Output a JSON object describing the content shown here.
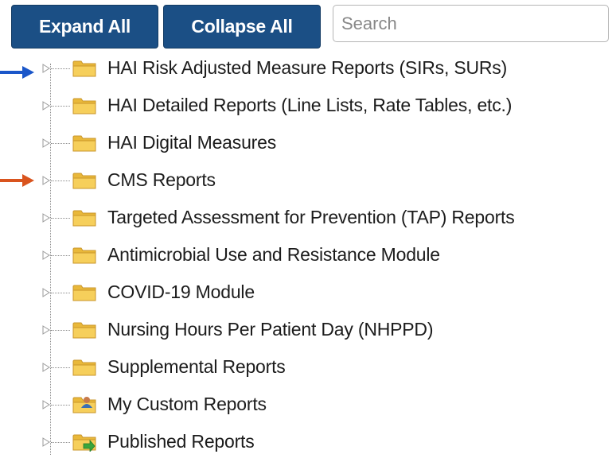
{
  "toolbar": {
    "expand_all_label": "Expand All",
    "collapse_all_label": "Collapse All",
    "search_placeholder": "Search"
  },
  "tree": {
    "items": [
      {
        "label": "HAI Risk Adjusted Measure Reports (SIRs, SURs)",
        "icon": "folder-icon"
      },
      {
        "label": "HAI Detailed Reports (Line Lists, Rate Tables, etc.)",
        "icon": "folder-icon"
      },
      {
        "label": "HAI Digital Measures",
        "icon": "folder-icon"
      },
      {
        "label": "CMS Reports",
        "icon": "folder-icon"
      },
      {
        "label": "Targeted Assessment for Prevention (TAP) Reports",
        "icon": "folder-icon"
      },
      {
        "label": "Antimicrobial Use and Resistance Module",
        "icon": "folder-icon"
      },
      {
        "label": "COVID-19 Module",
        "icon": "folder-icon"
      },
      {
        "label": "Nursing Hours Per Patient Day (NHPPD)",
        "icon": "folder-icon"
      },
      {
        "label": "Supplemental Reports",
        "icon": "folder-icon"
      },
      {
        "label": "My Custom Reports",
        "icon": "user-folder-icon"
      },
      {
        "label": "Published Reports",
        "icon": "published-folder-icon"
      }
    ]
  },
  "annotations": [
    {
      "icon": "blue-arrow-icon",
      "color": "#1a56c9",
      "points_to": "HAI Risk Adjusted Measure Reports (SIRs, SURs)"
    },
    {
      "icon": "orange-arrow-icon",
      "color": "#d9541e",
      "points_to": "CMS Reports"
    }
  ],
  "colors": {
    "button_bg": "#1b4f85",
    "folder_yellow": "#f3c54a"
  }
}
